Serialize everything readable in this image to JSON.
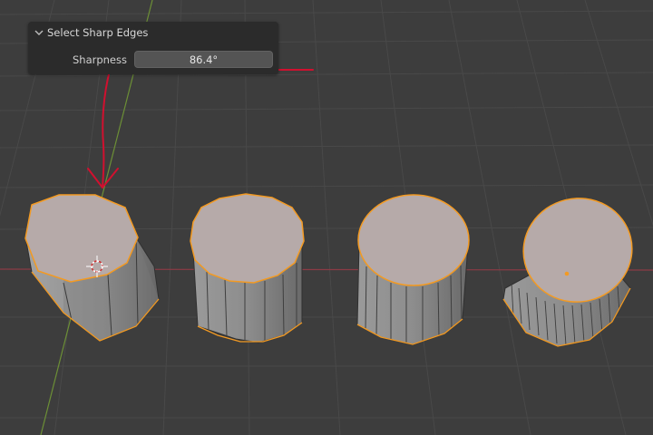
{
  "operator_panel": {
    "title": "Select Sharp Edges",
    "sharpness_label": "Sharpness",
    "sharpness_value": "86.4°"
  },
  "icons": {
    "collapse": "chevron-down-icon",
    "cursor": "3d-cursor-icon"
  },
  "colors": {
    "background": "#3d3d3d",
    "grid_line": "#4a4a4a",
    "x_axis": "#8c3b45",
    "y_axis": "#6c8f36",
    "selection_outline": "#f39a22",
    "selected_face": "#b6aaa9",
    "side_face": "#8a8a8a",
    "annotation": "#d1102f"
  }
}
